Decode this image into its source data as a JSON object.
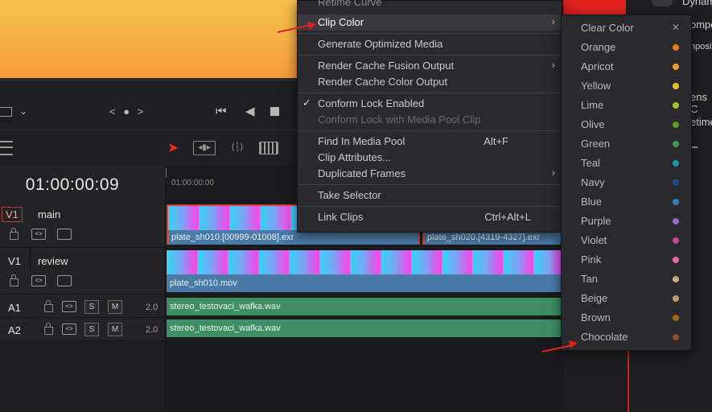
{
  "transport": {
    "dots": "< ● >"
  },
  "timeline": {
    "timecode": "01:00:00:09",
    "ruler_timecode": "01:00:00:00",
    "tracks": [
      {
        "id": "V1",
        "name": "main"
      },
      {
        "id": "V1",
        "name": "review"
      },
      {
        "id": "A1",
        "volume": "2.0"
      },
      {
        "id": "A2",
        "volume": "2.0"
      }
    ],
    "clips": {
      "main_1": "plate_sh010.[00999-01008].exr",
      "main_2": "plate_sh020.[4319-4327].exr",
      "review": "plate_sh010.mov",
      "a1": "stereo_testovaci_wafka.wav",
      "a2": "stereo_testovaci_wafka.wav"
    },
    "solo_label": "S",
    "mute_label": "M"
  },
  "context_menu": {
    "items": [
      {
        "label": "Retime Curve"
      },
      {
        "label": "Clip Color",
        "submenu": true
      },
      {
        "label": "Generate Optimized Media"
      },
      {
        "label": "Render Cache Fusion Output",
        "submenu": true
      },
      {
        "label": "Render Cache Color Output"
      },
      {
        "label": "Conform Lock Enabled",
        "checked": true
      },
      {
        "label": "Conform Lock with Media Pool Clip",
        "disabled": true
      },
      {
        "label": "Find In Media Pool",
        "shortcut": "Alt+F"
      },
      {
        "label": "Clip Attributes..."
      },
      {
        "label": "Duplicated Frames",
        "submenu": true
      },
      {
        "label": "Take Selector"
      },
      {
        "label": "Link Clips",
        "shortcut": "Ctrl+Alt+L"
      }
    ]
  },
  "clip_color_submenu": {
    "items": [
      {
        "label": "Clear Color",
        "color": ""
      },
      {
        "label": "Orange",
        "color": "#e8781e"
      },
      {
        "label": "Apricot",
        "color": "#f0a030"
      },
      {
        "label": "Yellow",
        "color": "#e6c21e"
      },
      {
        "label": "Lime",
        "color": "#9cc62a"
      },
      {
        "label": "Olive",
        "color": "#5a9a2a"
      },
      {
        "label": "Green",
        "color": "#3e9a5a"
      },
      {
        "label": "Teal",
        "color": "#1e9aa0"
      },
      {
        "label": "Navy",
        "color": "#1e4e8a"
      },
      {
        "label": "Blue",
        "color": "#3a7ac0"
      },
      {
        "label": "Purple",
        "color": "#9a6ac0"
      },
      {
        "label": "Violet",
        "color": "#c04a8a"
      },
      {
        "label": "Pink",
        "color": "#e86aa8"
      },
      {
        "label": "Tan",
        "color": "#c8a880"
      },
      {
        "label": "Beige",
        "color": "#c09a70"
      },
      {
        "label": "Brown",
        "color": "#a0661e"
      },
      {
        "label": "Chocolate",
        "color": "#8a4e2a"
      }
    ]
  },
  "inspector": {
    "lines": [
      "Dynam",
      "ompo",
      "nposi",
      "ens C",
      "etime"
    ]
  }
}
